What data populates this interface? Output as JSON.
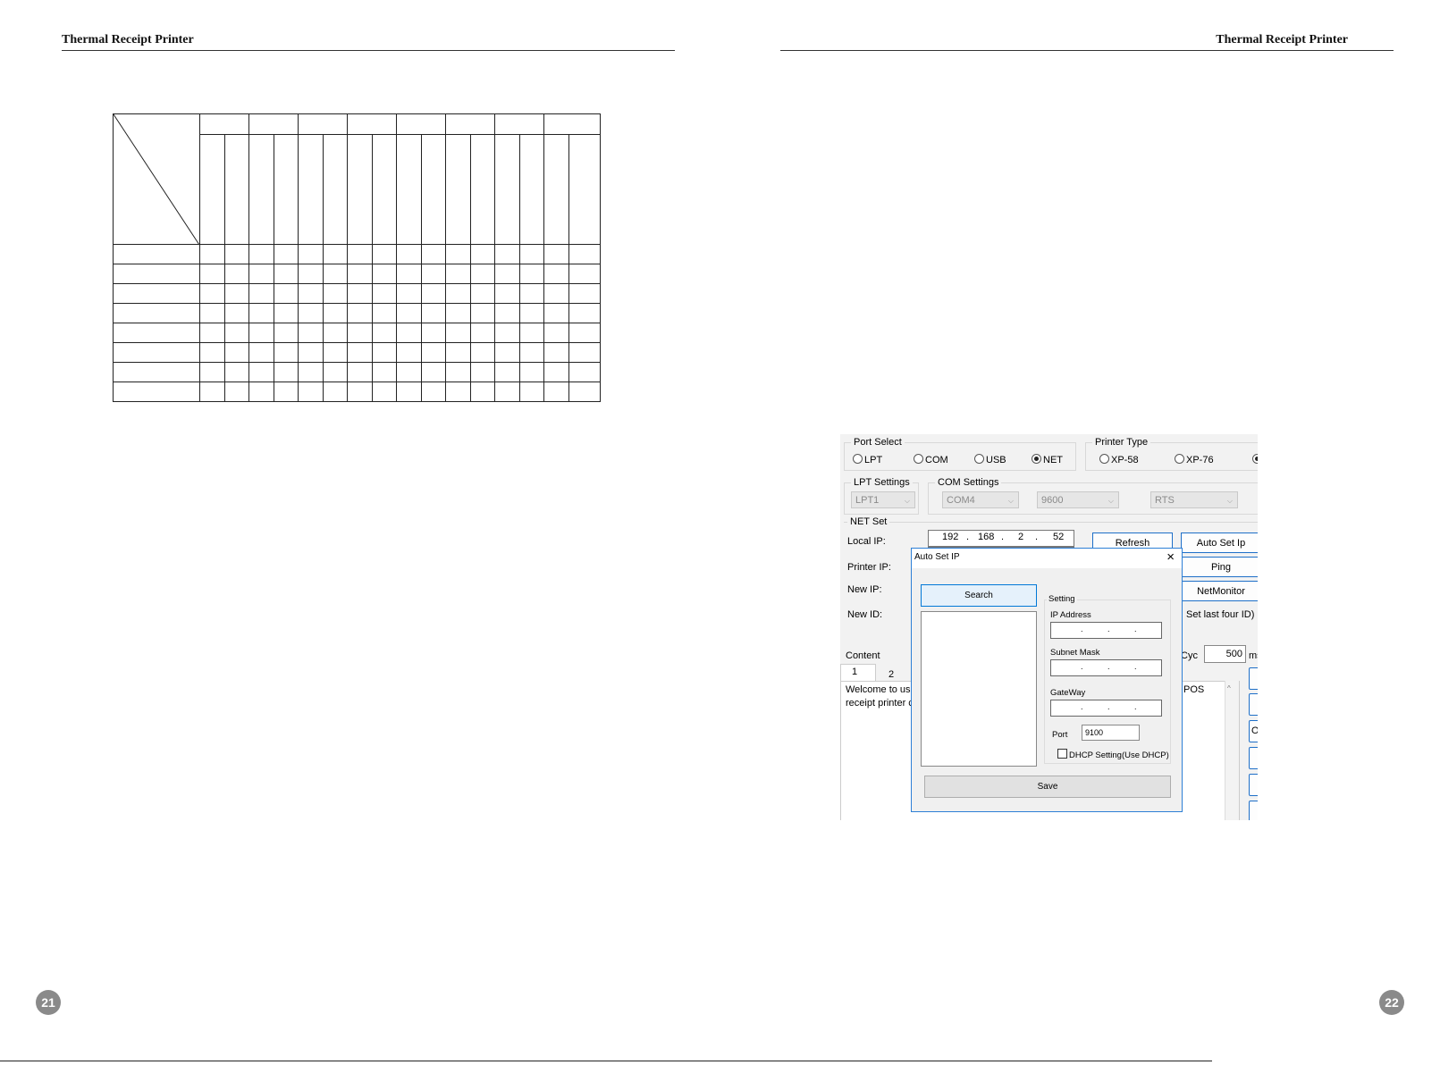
{
  "header": {
    "left_title": "Thermal Receipt Printer",
    "right_title": "Thermal Receipt Printer"
  },
  "page_numbers": {
    "left": "21",
    "right": "22"
  },
  "table": {
    "top_groups": 8,
    "sub_columns": 16,
    "body_rows": 8
  },
  "app": {
    "port_select": {
      "label": "Port Select",
      "options": [
        "LPT",
        "COM",
        "USB",
        "NET"
      ],
      "selected": "NET"
    },
    "printer_type": {
      "label": "Printer Type",
      "options": [
        "XP-58",
        "XP-76"
      ]
    },
    "lpt_settings": {
      "label": "LPT Settings",
      "port": "LPT1"
    },
    "com_settings": {
      "label": "COM Settings",
      "port": "COM4",
      "baud": "9600",
      "flow": "RTS"
    },
    "net_set": {
      "label": "NET Set",
      "local_ip_label": "Local IP:",
      "local_ip": [
        "192",
        "168",
        "2",
        "52"
      ],
      "printer_ip_label": "Printer IP:",
      "new_ip_label": "New IP:",
      "new_id_label": "New ID:",
      "set_last_four_id": "Set last four ID)",
      "refresh_label": "Refresh",
      "auto_set_ip_label": "Auto Set Ip",
      "ping_label": "Ping",
      "netmonitor_label": "NetMonitor"
    },
    "content": {
      "label": "Content",
      "tab1": "1",
      "tab2": "2",
      "cyc_label": "Cyc",
      "cyc_value": "500",
      "cyc_unit": "ms",
      "text_line1": "Welcome to use",
      "text_line2": "receipt printer co",
      "pos_text": "POS",
      "side_op": "Op"
    },
    "dialog": {
      "title": "Auto Set IP",
      "close_glyph": "×",
      "search_label": "Search",
      "setting_label": "Setting",
      "ip_address_label": "IP Address",
      "subnet_mask_label": "Subnet Mask",
      "gateway_label": "GateWay",
      "port_label": "Port",
      "port_value": "9100",
      "dhcp_label": "DHCP Setting(Use DHCP)",
      "save_label": "Save"
    }
  }
}
